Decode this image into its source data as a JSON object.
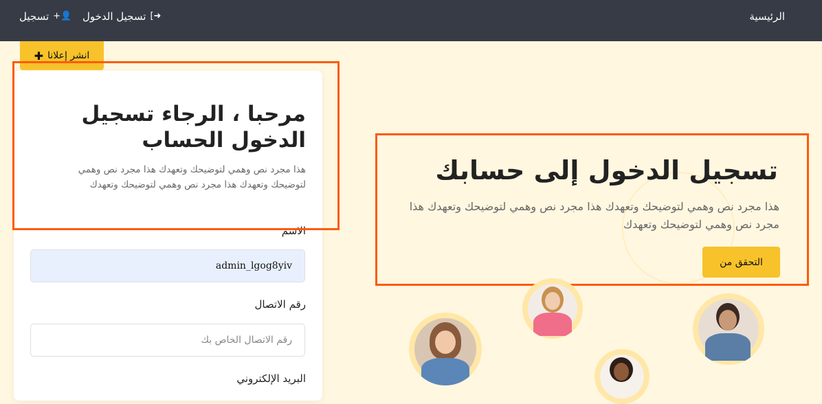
{
  "nav": {
    "home": "الرئيسية",
    "login": "تسجيل الدخول",
    "register": "تسجيل"
  },
  "post_ad": {
    "label": "انشر إعلانا"
  },
  "form_card": {
    "title": "مرحبا ، الرجاء تسجيل الدخول الحساب",
    "text": "هذا مجرد نص وهمي لتوضيحك وتعهدك هذا مجرد نص وهمي لتوضيحك وتعهدك هذا مجرد نص وهمي لتوضيحك وتعهدك",
    "name_label": "الاسم",
    "name_value": "admin_lgog8yiv",
    "phone_label": "رقم الاتصال",
    "phone_placeholder": "رقم الاتصال الخاص بك",
    "email_label": "البريد الإلكتروني"
  },
  "hero": {
    "title": "تسجيل الدخول إلى حسابك",
    "text": "هذا مجرد نص وهمي لتوضيحك وتعهدك هذا مجرد نص وهمي لتوضيحك وتعهدك هذا مجرد نص وهمي لتوضيحك وتعهدك",
    "verify_button": "التحقق من"
  },
  "icons": {
    "login": "sign-in-icon",
    "register": "user-plus-icon",
    "post_ad": "plus-icon"
  },
  "colors": {
    "navbar": "#363b45",
    "accent": "#f8c22a",
    "highlight": "#ff5a0a",
    "background": "#fff7e0"
  }
}
